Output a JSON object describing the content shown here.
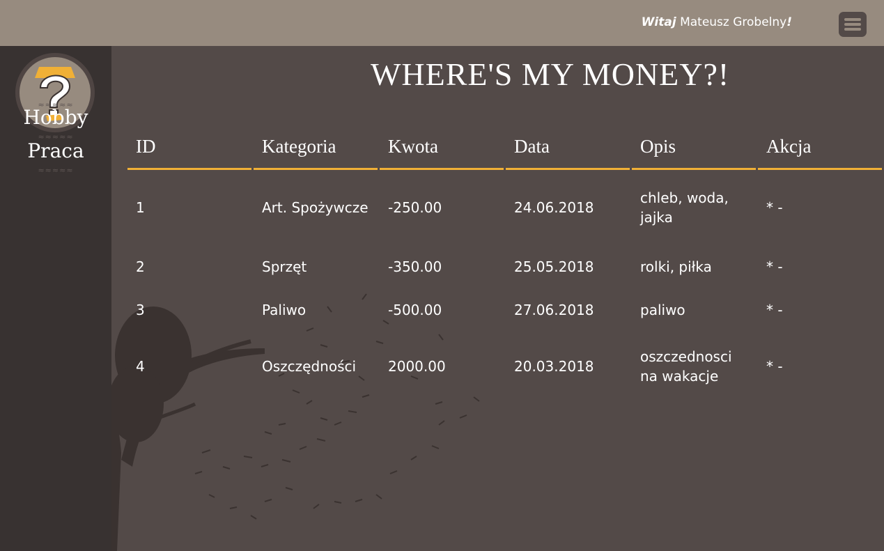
{
  "header": {
    "greeting_prefix": "Witaj",
    "user_name": "Mateusz Grobelny",
    "greeting_suffix": "!"
  },
  "sidebar": {
    "items": [
      {
        "label": "Hobby"
      },
      {
        "label": "Praca"
      }
    ]
  },
  "main": {
    "title": "WHERE'S MY MONEY?!",
    "table": {
      "headers": [
        "ID",
        "Kategoria",
        "Kwota",
        "Data",
        "Opis",
        "Akcja"
      ],
      "rows": [
        [
          "1",
          "Art. Spożywcze",
          "-250.00",
          "24.06.2018",
          "chleb, woda, jajka",
          "* -"
        ],
        [
          "2",
          "Sprzęt",
          "-350.00",
          "25.05.2018",
          "rolki, piłka",
          "* -"
        ],
        [
          "3",
          "Paliwo",
          "-500.00",
          "27.06.2018",
          "paliwo",
          "* -"
        ],
        [
          "4",
          "Oszczędności",
          "2000.00",
          "20.03.2018",
          "oszczednosci na wakacje",
          "* -"
        ]
      ]
    }
  },
  "colors": {
    "topbar": "#978b7f",
    "sidebar": "#383231",
    "background": "#534a48",
    "accent_underline": "#f0b036"
  },
  "icons": {
    "logo": "question-mark-logo-icon",
    "menu": "hamburger-menu-icon",
    "background_art": "money-tree-illustration"
  }
}
